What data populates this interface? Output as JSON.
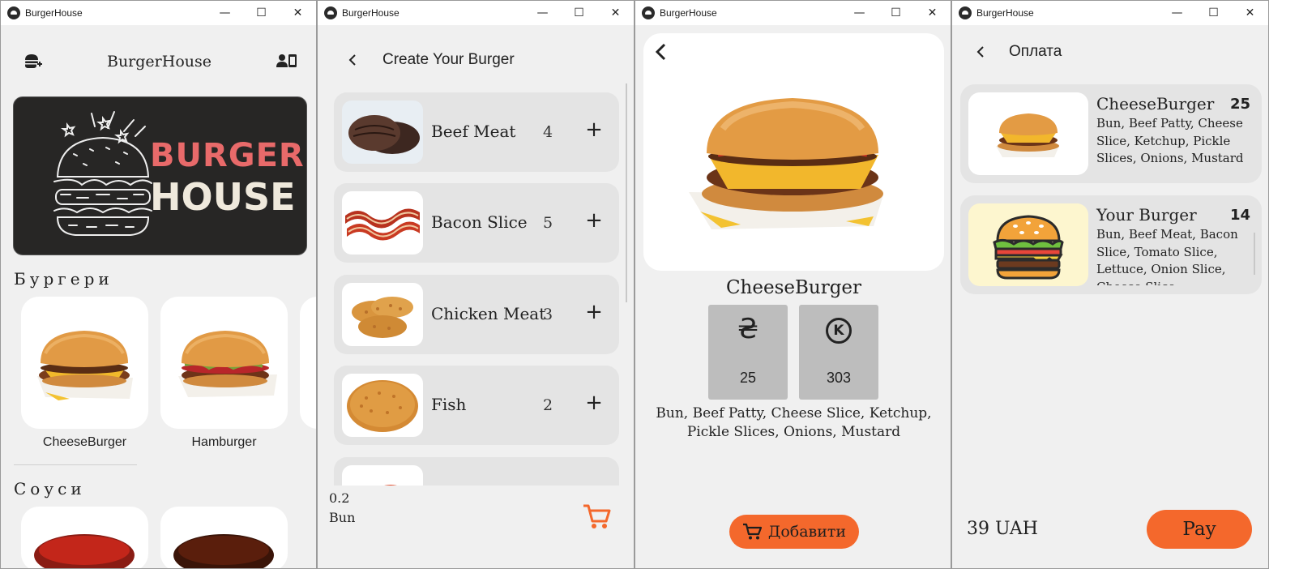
{
  "window_controls": {
    "minimize": "—",
    "maximize": "☐",
    "close": "✕"
  },
  "windows": [
    {
      "title": "BurgerHouse"
    },
    {
      "title": "BurgerHouse"
    },
    {
      "title": "BurgerHouse"
    },
    {
      "title": "BurgerHouse"
    }
  ],
  "home": {
    "app_title": "BurgerHouse",
    "banner": {
      "word1": "BURGER",
      "word2": "HOUSE"
    },
    "section_burgers": "Бургери",
    "burgers": [
      {
        "name": "CheeseBurger"
      },
      {
        "name": "Hamburger"
      }
    ],
    "section_sauces": "Соуси",
    "colors": {
      "banner_bg": "#272625",
      "banner_burger": "#e86a6a",
      "banner_house": "#efe9dc"
    }
  },
  "builder": {
    "title": "Create Your Burger",
    "ingredients": [
      {
        "name": "Beef Meat",
        "count": "4",
        "icon": "beef-patty"
      },
      {
        "name": "Bacon Slice",
        "count": "5",
        "icon": "bacon"
      },
      {
        "name": "Chicken Meat",
        "count": "3",
        "icon": "chicken-patty"
      },
      {
        "name": "Fish",
        "count": "2",
        "icon": "fish-patty"
      }
    ],
    "plus_label": "+",
    "footer_amount": "0.2",
    "footer_item": "Bun",
    "cart_icon": "cart-icon"
  },
  "product": {
    "name": "CheeseBurger",
    "price_uah": "25",
    "price_points": "303",
    "currency_symbol": "₴",
    "points_symbol": "K",
    "description": "Bun, Beef Patty, Cheese Slice, Ketchup, Pickle Slices, Onions, Mustard",
    "add_button": "Добавити",
    "accent": "#f4682c"
  },
  "checkout": {
    "title": "Оплата",
    "items": [
      {
        "name": "CheeseBurger",
        "qty": "25",
        "desc": "Bun, Beef Patty, Cheese Slice, Ketchup, Pickle Slices, Onions, Mustard"
      },
      {
        "name": "Your Burger",
        "qty": "14",
        "desc": "Bun, Beef Meat, Bacon Slice, Tomato Slice, Lettuce, Onion Slice, Cheese Slice"
      }
    ],
    "total": "39 UAH",
    "pay_button": "Pay"
  }
}
